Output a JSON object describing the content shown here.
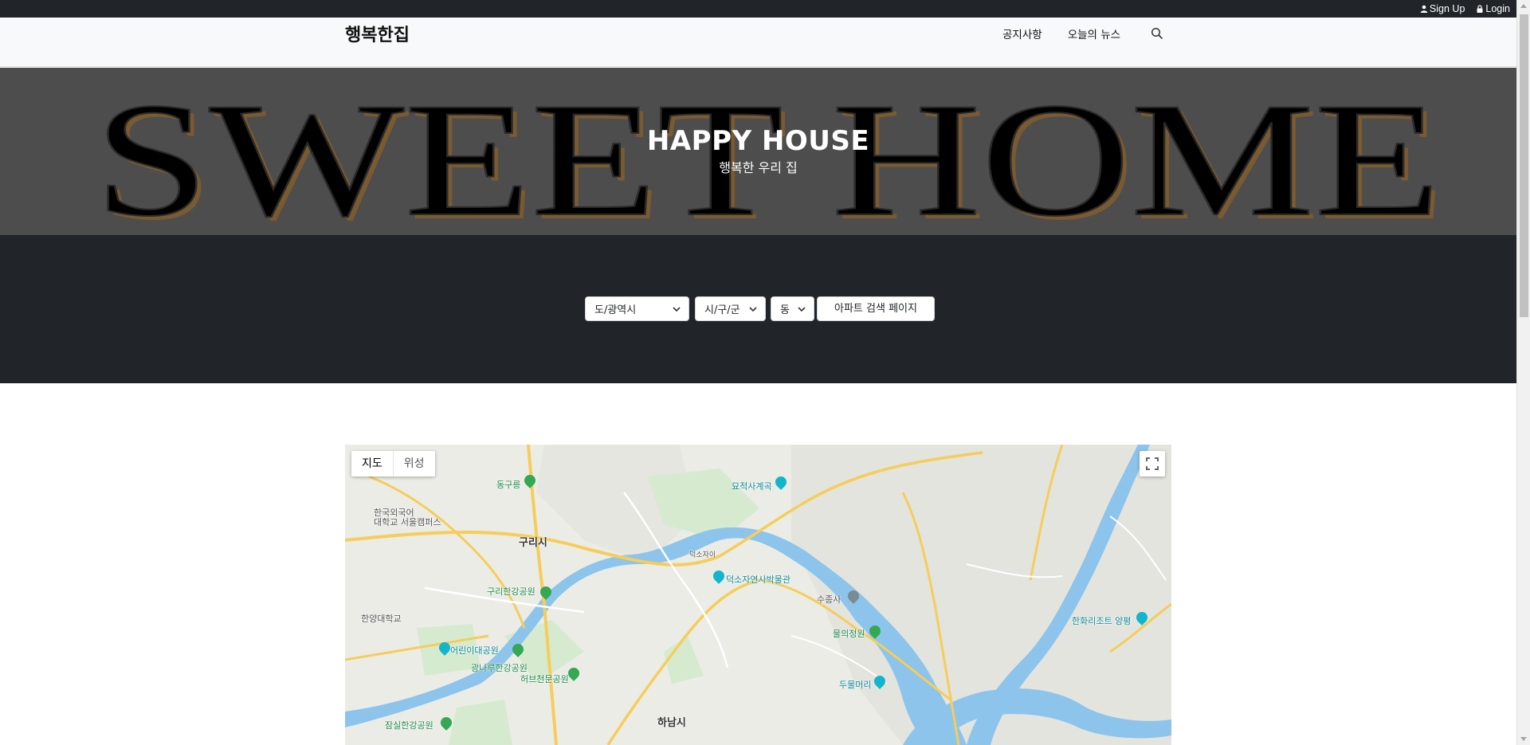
{
  "topbar": {
    "signup_label": "Sign Up",
    "login_label": "Login"
  },
  "navbar": {
    "brand": "행복한집",
    "items": [
      {
        "label": "공지사항"
      },
      {
        "label": "오늘의 뉴스"
      }
    ]
  },
  "hero": {
    "background_text": "SWEET HOME",
    "title": "HAPPY HOUSE",
    "subtitle": "행복한 우리 집"
  },
  "search": {
    "sido_selected": "도/광역시",
    "gugun_selected": "시/구/군",
    "dong_selected": "동",
    "apt_button_label": "아파트 검색 페이지"
  },
  "map": {
    "type_map_label": "지도",
    "type_satellite_label": "위성",
    "labels": {
      "guri": "구리시",
      "hanam": "하남시",
      "dongguneung": "동구릉",
      "guri_park": "구리한강공원",
      "childrens_park": "어린이대공원",
      "gwangnaru_park": "광나루한강공원",
      "heobeu_park": "허브천문공원",
      "jamsil_park": "잠실한강공원",
      "hufs": "한국외국어\n대학교 서울캠퍼스",
      "hanyang": "한양대학교",
      "myojeok": "묘적사계곡",
      "deokso_museum": "덕소자연사박물관",
      "sujongsa": "수종사",
      "mulsum": "물의정원",
      "dumulmeori": "두물머리",
      "hanwha": "한화리조트 양평",
      "deokso_station": "덕소자이"
    },
    "colors": {
      "land": "#e8eae4",
      "water": "#7ab8e6",
      "park": "#cfe8c7",
      "road": "#f9d36e",
      "road_white": "#ffffff"
    }
  }
}
